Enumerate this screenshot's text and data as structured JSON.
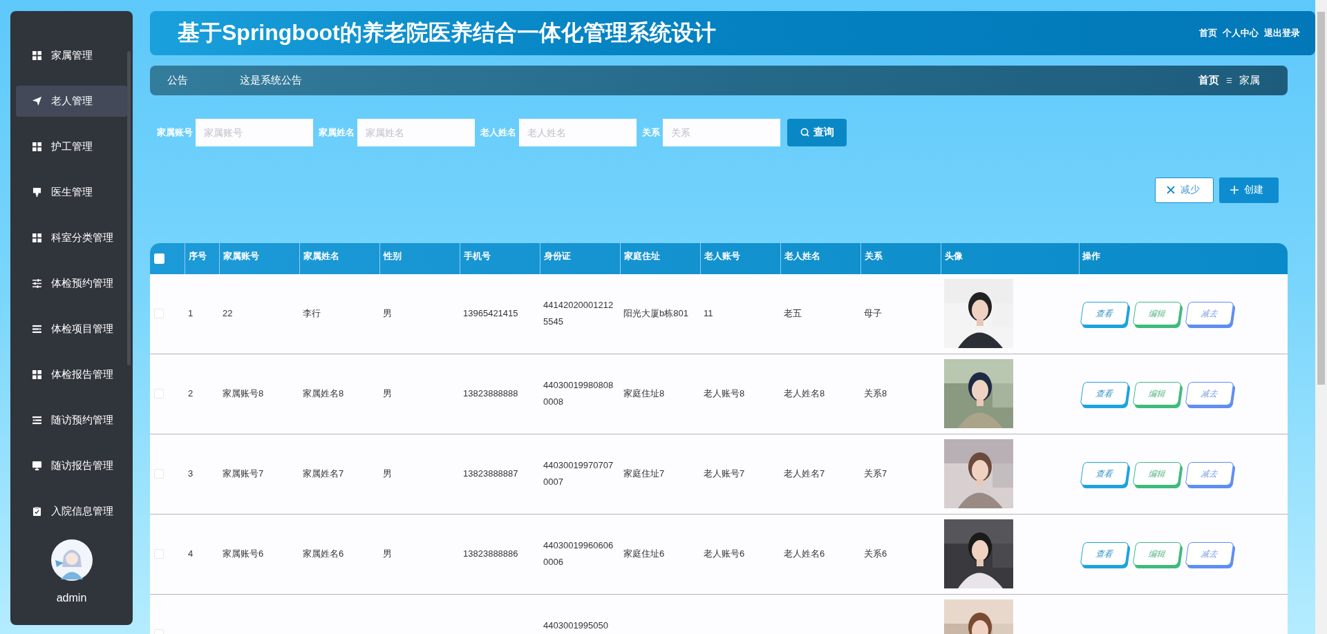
{
  "sidebar": {
    "items": [
      {
        "label": "家属管理",
        "kind": "grid",
        "selected": false
      },
      {
        "label": "老人管理",
        "kind": "send",
        "selected": true
      },
      {
        "label": "护工管理",
        "kind": "grid",
        "selected": false
      },
      {
        "label": "医生管理",
        "kind": "brush",
        "selected": false
      },
      {
        "label": "科室分类管理",
        "kind": "grid",
        "selected": false
      },
      {
        "label": "体检预约管理",
        "kind": "sliders",
        "selected": false
      },
      {
        "label": "体检项目管理",
        "kind": "indent",
        "selected": false
      },
      {
        "label": "体检报告管理",
        "kind": "grid",
        "selected": false
      },
      {
        "label": "随访预约管理",
        "kind": "outdent",
        "selected": false
      },
      {
        "label": "随访报告管理",
        "kind": "monitor",
        "selected": false
      },
      {
        "label": "入院信息管理",
        "kind": "clipboard",
        "selected": false
      }
    ],
    "user": {
      "name": "admin"
    }
  },
  "header": {
    "title": "基于Springboot的养老院医养结合一体化管理系统设计",
    "links": [
      "首页",
      "个人中心",
      "退出登录"
    ]
  },
  "notice": {
    "label": "公告",
    "text": "这是系统公告",
    "breadcrumb": [
      "首页",
      "家属"
    ]
  },
  "search": {
    "fields": [
      {
        "label": "家属账号",
        "placeholder": "家属账号"
      },
      {
        "label": "家属姓名",
        "placeholder": "家属姓名"
      },
      {
        "label": "老人姓名",
        "placeholder": "老人姓名"
      },
      {
        "label": "关系",
        "placeholder": "关系"
      }
    ],
    "button": "查询"
  },
  "actions": [
    {
      "kind": "delete",
      "label": "减少"
    },
    {
      "kind": "create",
      "label": "创建"
    }
  ],
  "table": {
    "select_all": {
      "checked": false
    },
    "columns": [
      "序号",
      "家属账号",
      "家属姓名",
      "性别",
      "手机号",
      "身份证",
      "家庭住址",
      "老人账号",
      "老人姓名",
      "关系",
      "头像",
      "操作"
    ],
    "rows": [
      {
        "checked": false,
        "cells": [
          "1",
          "22",
          "李行",
          "男",
          "13965421415",
          "441420200012125545",
          "阳光大厦b栋801",
          "11",
          "老五",
          "母子"
        ],
        "photo": {
          "kind": "picture"
        },
        "buttons": [
          {
            "kind": "view",
            "label": "查看"
          },
          {
            "kind": "edit",
            "label": "编辑"
          },
          {
            "kind": "delete",
            "label": "减去"
          }
        ]
      },
      {
        "checked": false,
        "cells": [
          "2",
          "家属账号8",
          "家属姓名8",
          "男",
          "13823888888",
          "440300199808080008",
          "家庭住址8",
          "老人账号8",
          "老人姓名8",
          "关系8"
        ],
        "photo": {
          "kind": "picture"
        },
        "buttons": [
          {
            "kind": "view",
            "label": "查看"
          },
          {
            "kind": "edit",
            "label": "编辑"
          },
          {
            "kind": "delete",
            "label": "减去"
          }
        ]
      },
      {
        "checked": false,
        "cells": [
          "3",
          "家属账号7",
          "家属姓名7",
          "男",
          "13823888887",
          "440300199707070007",
          "家庭住址7",
          "老人账号7",
          "老人姓名7",
          "关系7"
        ],
        "photo": {
          "kind": "picture"
        },
        "buttons": [
          {
            "kind": "view",
            "label": "查看"
          },
          {
            "kind": "edit",
            "label": "编辑"
          },
          {
            "kind": "delete",
            "label": "减去"
          }
        ]
      },
      {
        "checked": false,
        "cells": [
          "4",
          "家属账号6",
          "家属姓名6",
          "男",
          "13823888886",
          "440300199606060006",
          "家庭住址6",
          "老人账号6",
          "老人姓名6",
          "关系6"
        ],
        "photo": {
          "kind": "picture"
        },
        "buttons": [
          {
            "kind": "view",
            "label": "查看"
          },
          {
            "kind": "edit",
            "label": "编辑"
          },
          {
            "kind": "delete",
            "label": "减去"
          }
        ]
      },
      {
        "checked": false,
        "cells": [
          null,
          null,
          null,
          null,
          null,
          "4403001995050",
          null,
          null,
          null,
          null
        ],
        "photo": {
          "kind": "picture"
        }
      }
    ]
  }
}
